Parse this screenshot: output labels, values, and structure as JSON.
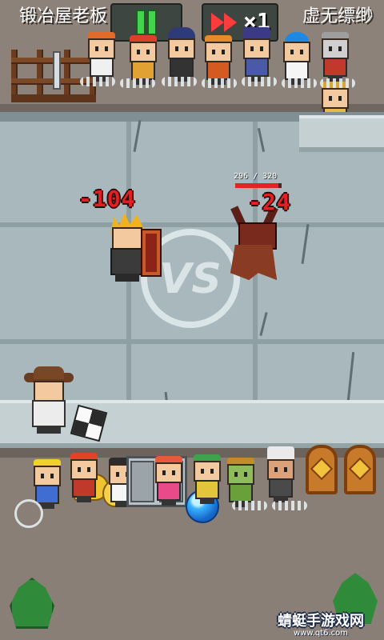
{
  "hud": {
    "left_name": "锻冶屋老板",
    "right_name": "虚无缥缈",
    "speed_label": "×1"
  },
  "battle": {
    "enemy_hp_readout": "296 / 320",
    "enemy_hp_fraction": 0.925,
    "hero_damage": "-104",
    "enemy_damage": "-24",
    "vs_label": "VS"
  },
  "watermark": {
    "title": "蜻蜓手游戏网",
    "url": "www.qt6.com"
  },
  "colors": {
    "damage": "#e51f22",
    "pause_green": "#42d44a",
    "ff_red": "#ff3b3b"
  }
}
